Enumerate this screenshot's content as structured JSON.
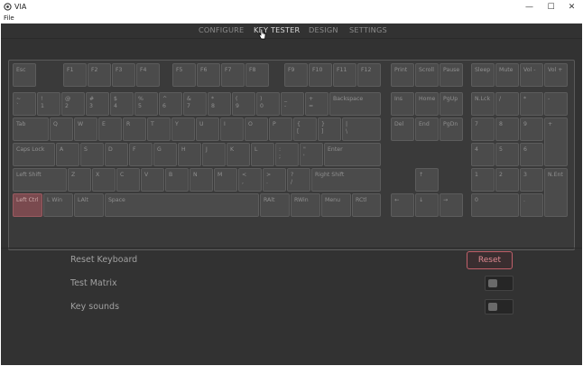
{
  "window": {
    "title": "VIA",
    "controls": {
      "minimize": "—",
      "maximize": "☐",
      "close": "✕"
    }
  },
  "menubar": {
    "file": "File"
  },
  "nav": {
    "tabs": [
      {
        "label": "CONFIGURE",
        "active": false
      },
      {
        "label": "KEY TESTER",
        "active": true
      },
      {
        "label": "DESIGN",
        "active": false
      },
      {
        "label": "SETTINGS",
        "active": false
      }
    ]
  },
  "keyboard": {
    "pressed_key": "Left Ctrl",
    "pressed_color": "#7a4a4f",
    "keys": [
      "Esc",
      "F1",
      "F2",
      "F3",
      "F4",
      "F5",
      "F6",
      "F7",
      "F8",
      "F9",
      "F10",
      "F11",
      "F12",
      "Print",
      "Scroll",
      "Pause",
      "Sleep",
      "Mute",
      "Vol -",
      "Vol +",
      "~\n`",
      "!\n1",
      "@\n2",
      "#\n3",
      "$\n4",
      "%\n5",
      "^\n6",
      "&\n7",
      "*\n8",
      "(\n9",
      ")\n0",
      "_\n-",
      "+\n=",
      "Backspace",
      "Ins",
      "Home",
      "PgUp",
      "N.Lck",
      "/",
      "*",
      "-",
      "Tab",
      "Q",
      "W",
      "E",
      "R",
      "T",
      "Y",
      "U",
      "I",
      "O",
      "P",
      "{\n[",
      "}\n]",
      "|\n\\",
      "Del",
      "End",
      "PgDn",
      "7",
      "8",
      "9",
      "+",
      "Caps Lock",
      "A",
      "S",
      "D",
      "F",
      "G",
      "H",
      "J",
      "K",
      "L",
      ":\n;",
      "\"\n'",
      "Enter",
      "4",
      "5",
      "6",
      "Left Shift",
      "Z",
      "X",
      "C",
      "V",
      "B",
      "N",
      "M",
      "<\n,",
      ">\n.",
      "?\n/",
      "Right Shift",
      "↑",
      "1",
      "2",
      "3",
      "N.Ent",
      "Left Ctrl",
      "L Win",
      "LAlt",
      "Space",
      "RAlt",
      "RWin",
      "Menu",
      "RCtl",
      "←",
      "↓",
      "→",
      "0",
      "."
    ]
  },
  "settings": {
    "reset_keyboard_label": "Reset Keyboard",
    "reset_button_label": "Reset",
    "test_matrix_label": "Test Matrix",
    "test_matrix_on": false,
    "key_sounds_label": "Key sounds",
    "key_sounds_on": false
  }
}
